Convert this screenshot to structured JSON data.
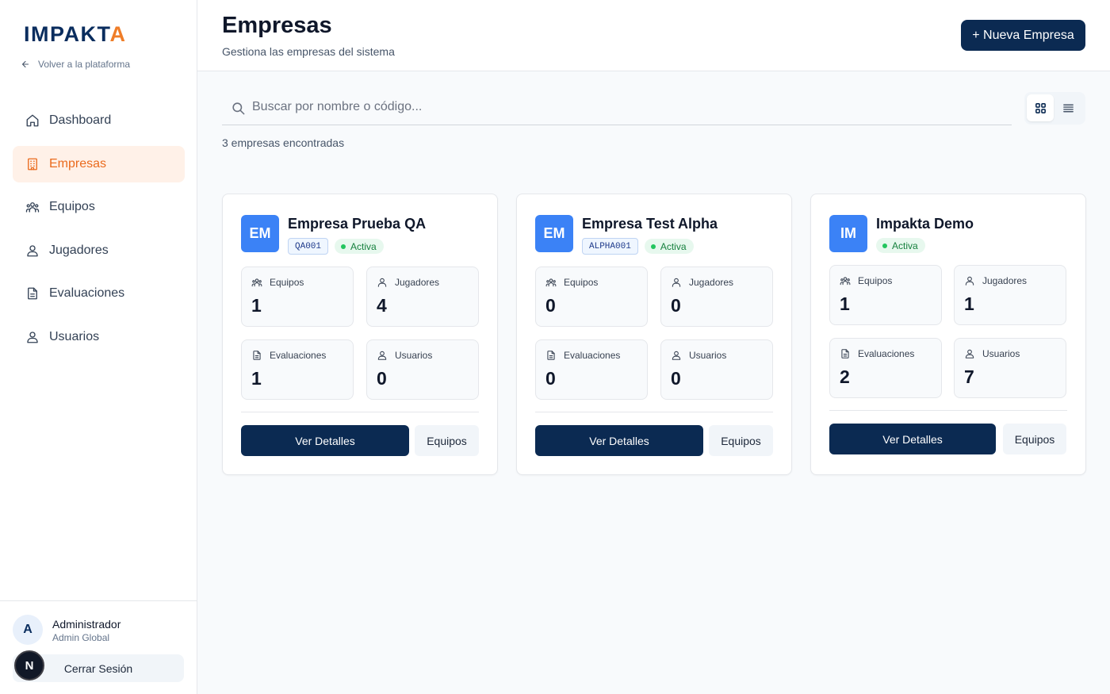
{
  "sidebar": {
    "logo_main": "IMPAKT",
    "logo_accent": "A",
    "back_label": "Volver a la plataforma",
    "items": [
      {
        "label": "Dashboard",
        "icon": "home-icon"
      },
      {
        "label": "Empresas",
        "icon": "building-icon",
        "active": true
      },
      {
        "label": "Equipos",
        "icon": "team-icon"
      },
      {
        "label": "Jugadores",
        "icon": "users-icon"
      },
      {
        "label": "Evaluaciones",
        "icon": "document-icon"
      },
      {
        "label": "Usuarios",
        "icon": "users-icon"
      }
    ],
    "user": {
      "initial": "A",
      "name": "Administrador",
      "role": "Admin Global"
    },
    "logout_label": "Cerrar Sesión",
    "dev_badge": "N"
  },
  "header": {
    "title": "Empresas",
    "subtitle": "Gestiona las empresas del sistema",
    "new_button": "+ Nueva Empresa"
  },
  "search": {
    "placeholder": "Buscar por nombre o código...",
    "value": ""
  },
  "view_mode": "grid",
  "result_count": "3 empresas encontradas",
  "stat_labels": {
    "teams": "Equipos",
    "players": "Jugadores",
    "evaluations": "Evaluaciones",
    "users": "Usuarios"
  },
  "companies": [
    {
      "initials": "EM",
      "name": "Empresa Prueba QA",
      "code": "QA001",
      "status": "Activa",
      "teams": "1",
      "players": "4",
      "evaluations": "1",
      "users": "0",
      "details_label": "Ver Detalles",
      "teams_label": "Equipos"
    },
    {
      "initials": "EM",
      "name": "Empresa Test Alpha",
      "code": "ALPHA001",
      "status": "Activa",
      "teams": "0",
      "players": "0",
      "evaluations": "0",
      "users": "0",
      "details_label": "Ver Detalles",
      "teams_label": "Equipos"
    },
    {
      "initials": "IM",
      "name": "Impakta Demo",
      "code": "",
      "status": "Activa",
      "teams": "1",
      "players": "1",
      "evaluations": "2",
      "users": "7",
      "details_label": "Ver Detalles",
      "teams_label": "Equipos"
    }
  ],
  "colors": {
    "brand_navy": "#0b2a52",
    "brand_orange": "#ea6b1e",
    "avatar_blue": "#3b82f6",
    "status_green": "#22c55e"
  }
}
